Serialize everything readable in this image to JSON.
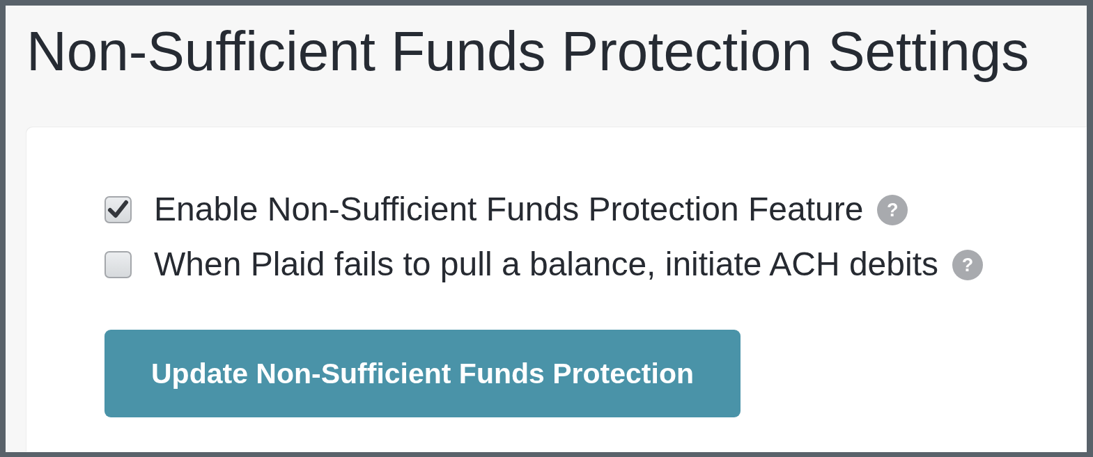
{
  "title": "Non-Sufficient Funds Protection Settings",
  "options": [
    {
      "label": "Enable Non-Sufficient Funds Protection Feature",
      "checked": true,
      "help": "?"
    },
    {
      "label": "When Plaid fails to pull a balance, initiate ACH debits",
      "checked": false,
      "help": "?"
    }
  ],
  "button": {
    "label": "Update Non-Sufficient Funds Protection"
  }
}
